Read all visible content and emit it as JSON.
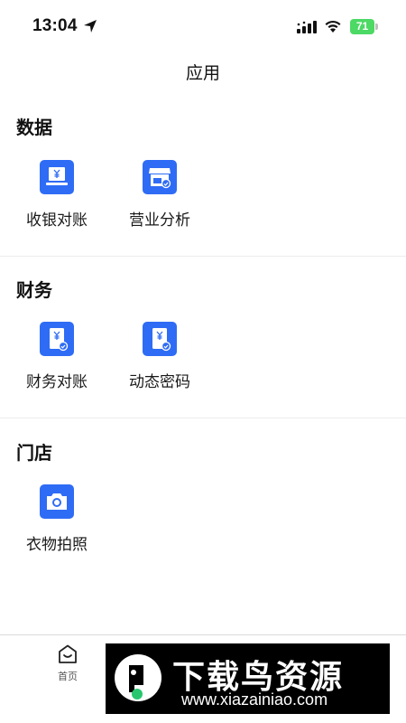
{
  "status_bar": {
    "time": "13:04",
    "battery": "71",
    "icons": [
      "location-arrow-icon",
      "cellular-signal-icon",
      "wifi-icon",
      "battery-icon"
    ]
  },
  "nav": {
    "title": "应用"
  },
  "sections": [
    {
      "title": "数据",
      "items": [
        {
          "label": "收银对账",
          "icon": "cash-register-icon"
        },
        {
          "label": "营业分析",
          "icon": "store-analytics-icon"
        }
      ]
    },
    {
      "title": "财务",
      "items": [
        {
          "label": "财务对账",
          "icon": "finance-document-check-icon"
        },
        {
          "label": "动态密码",
          "icon": "dynamic-password-icon"
        }
      ]
    },
    {
      "title": "门店",
      "items": [
        {
          "label": "衣物拍照",
          "icon": "camera-icon"
        }
      ]
    }
  ],
  "tabbar": {
    "home_label": "首页",
    "home_icon": "home-icon"
  },
  "watermark": {
    "title": "下载鸟资源",
    "url": "www.xiazainiao.com"
  },
  "colors": {
    "accent": "#2f6cf5",
    "battery": "#4cd964"
  }
}
